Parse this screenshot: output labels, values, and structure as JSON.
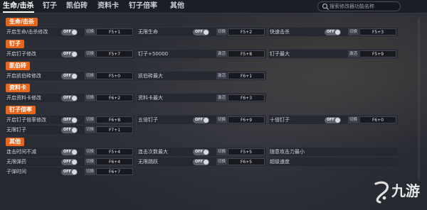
{
  "tabs": [
    {
      "label": "生命/击杀",
      "active": true
    },
    {
      "label": "钉子",
      "active": false
    },
    {
      "label": "凯伯砖",
      "active": false
    },
    {
      "label": "资料卡",
      "active": false
    },
    {
      "label": "钉子倍率",
      "active": false
    },
    {
      "label": "其他",
      "active": false
    }
  ],
  "search": {
    "placeholder": "搜索修改器功能名称"
  },
  "toggle_text": "OFF",
  "sections": [
    {
      "title": "生命/击杀",
      "rows": [
        [
          {
            "label": "开启生命/击杀修改",
            "toggle": true,
            "type": "切换",
            "key": "F5+1"
          },
          {
            "label": "无限生命",
            "toggle": true,
            "type": "切换",
            "key": "F5+2"
          },
          {
            "label": "快速击杀",
            "toggle": true,
            "type": "切换",
            "key": "F5+3"
          }
        ]
      ]
    },
    {
      "title": "钉子",
      "rows": [
        [
          {
            "label": "开启钉子修改",
            "toggle": true,
            "type": "切换",
            "key": "F5+7"
          },
          {
            "label": "钉子+50000",
            "toggle": false,
            "type": "激活",
            "key": "F5+8"
          },
          {
            "label": "钉子最大",
            "toggle": false,
            "type": "激活",
            "key": "F5+9"
          }
        ]
      ]
    },
    {
      "title": "凯伯砖",
      "rows": [
        [
          {
            "label": "开启凯伯砖修改",
            "toggle": true,
            "type": "切换",
            "key": "F5+0"
          },
          {
            "label": "凯伯砖最大",
            "toggle": false,
            "type": "激活",
            "key": "F6+1"
          }
        ]
      ]
    },
    {
      "title": "资料卡",
      "rows": [
        [
          {
            "label": "开启资料卡修改",
            "toggle": true,
            "type": "切换",
            "key": "F6+2"
          },
          {
            "label": "资料卡最大",
            "toggle": false,
            "type": "激活",
            "key": "F6+3"
          }
        ]
      ]
    },
    {
      "title": "钉子倍率",
      "rows": [
        [
          {
            "label": "开启钉子倍率修改",
            "toggle": true,
            "type": "切换",
            "key": "F6+8"
          },
          {
            "label": "五倍钉子",
            "toggle": true,
            "type": "切换",
            "key": "F6+9"
          },
          {
            "label": "十倍钉子",
            "toggle": true,
            "type": "切换",
            "key": "F6+0"
          }
        ],
        [
          {
            "label": "无限钉子",
            "toggle": true,
            "type": "切换",
            "key": "F7+1"
          }
        ]
      ]
    },
    {
      "title": "其他",
      "rows": [
        [
          {
            "label": "连击时间不减",
            "toggle": true,
            "type": "切换",
            "key": "F5+4"
          },
          {
            "label": "连击次数最大",
            "toggle": true,
            "type": "切换",
            "key": "F5+5"
          },
          {
            "label": "随意攻击力最小",
            "toggle": false,
            "type": "",
            "key": ""
          }
        ],
        [
          {
            "label": "无限弹药",
            "toggle": true,
            "type": "切换",
            "key": "F6+4"
          },
          {
            "label": "无限跳跃",
            "toggle": true,
            "type": "切换",
            "key": "F6+5"
          },
          {
            "label": "超级速度",
            "toggle": false,
            "type": "",
            "key": ""
          }
        ],
        [
          {
            "label": "子弹时间",
            "toggle": true,
            "type": "切换",
            "key": "F6+7"
          }
        ]
      ]
    }
  ],
  "watermark": {
    "text": "九游"
  },
  "colors": {
    "accent": "#e8651c",
    "panel": "#26282f",
    "tabbar": "#1c1e25"
  }
}
